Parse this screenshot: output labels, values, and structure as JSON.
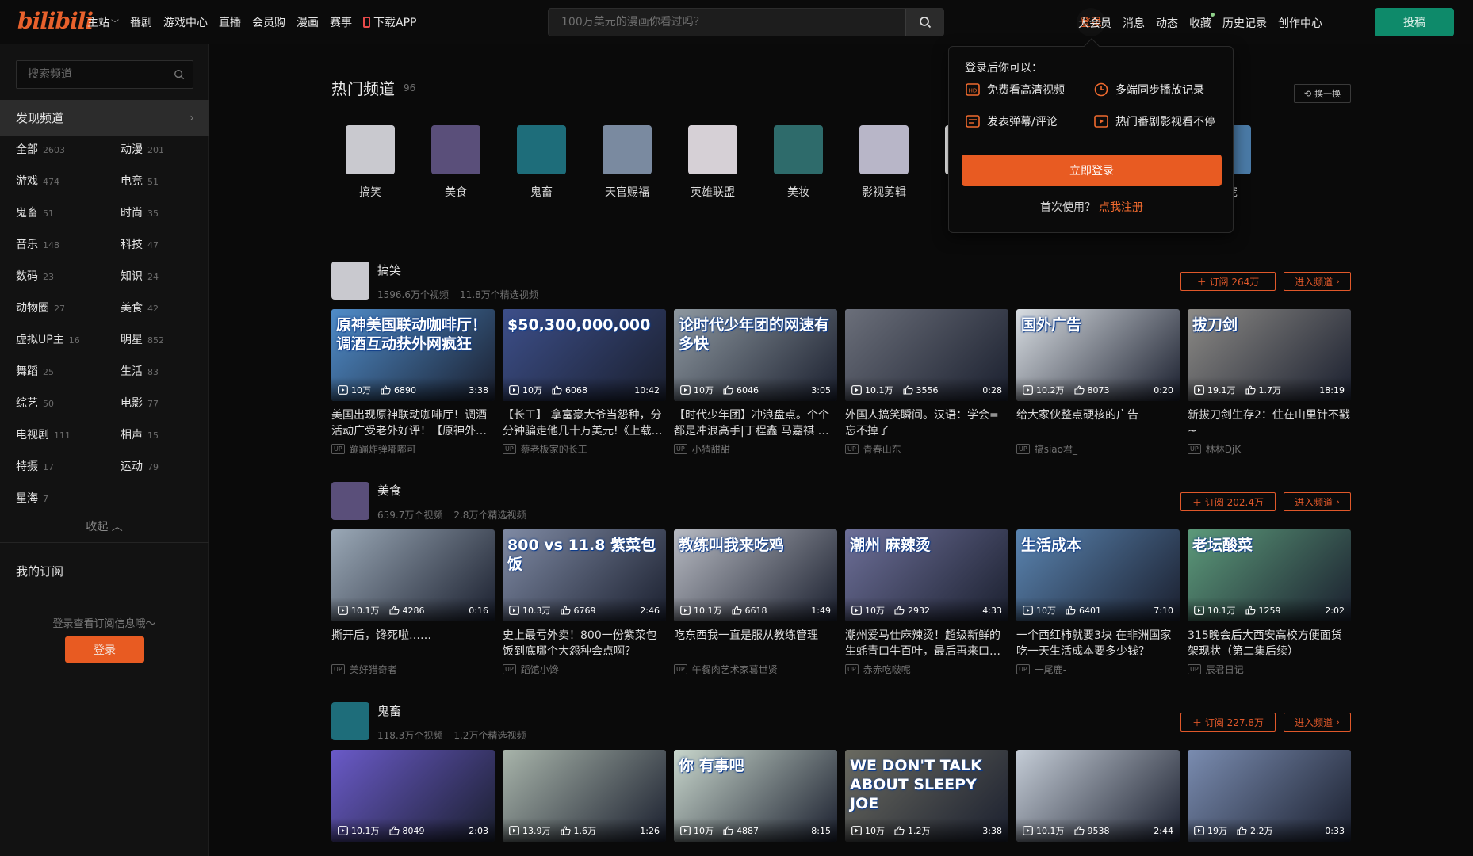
{
  "header": {
    "logo": "bilibili",
    "nav": [
      "主站",
      "番剧",
      "游戏中心",
      "直播",
      "会员购",
      "漫画",
      "赛事",
      "下载APP"
    ],
    "search_placeholder": "100万美元的漫画你看过吗？",
    "login": "登录",
    "right_nav": [
      "大会员",
      "消息",
      "动态",
      "收藏",
      "历史记录",
      "创作中心"
    ],
    "post": "投稿"
  },
  "sidebar": {
    "search_placeholder": "搜索频道",
    "discover": "发现频道",
    "categories": [
      {
        "name": "全部",
        "count": "2603"
      },
      {
        "name": "动漫",
        "count": "201"
      },
      {
        "name": "游戏",
        "count": "474"
      },
      {
        "name": "电竞",
        "count": "51"
      },
      {
        "name": "鬼畜",
        "count": "51"
      },
      {
        "name": "时尚",
        "count": "35"
      },
      {
        "name": "音乐",
        "count": "148"
      },
      {
        "name": "科技",
        "count": "47"
      },
      {
        "name": "数码",
        "count": "23"
      },
      {
        "name": "知识",
        "count": "24"
      },
      {
        "name": "动物圈",
        "count": "27"
      },
      {
        "name": "美食",
        "count": "42"
      },
      {
        "name": "虚拟UP主",
        "count": "16"
      },
      {
        "name": "明星",
        "count": "852"
      },
      {
        "name": "舞蹈",
        "count": "25"
      },
      {
        "name": "生活",
        "count": "83"
      },
      {
        "name": "综艺",
        "count": "50"
      },
      {
        "name": "电影",
        "count": "77"
      },
      {
        "name": "电视剧",
        "count": "111"
      },
      {
        "name": "相声",
        "count": "15"
      },
      {
        "name": "特摄",
        "count": "17"
      },
      {
        "name": "运动",
        "count": "79"
      },
      {
        "name": "星海",
        "count": "7"
      }
    ],
    "collapse": "收起",
    "my_sub": "我的订阅",
    "login_tip": "登录查看订阅信息哦～",
    "login_btn": "登录"
  },
  "hot": {
    "title": "热门频道",
    "count": "96",
    "refresh": "换一换",
    "channels": [
      {
        "name": "搞笑",
        "color": "#c9c9cf"
      },
      {
        "name": "美食",
        "color": "#5a4f7a"
      },
      {
        "name": "鬼畜",
        "color": "#1e6d7a"
      },
      {
        "name": "天官赐福",
        "color": "#7a8aa0"
      },
      {
        "name": "英雄联盟",
        "color": "#d6d0d6"
      },
      {
        "name": "美妆",
        "color": "#2e6b6b"
      },
      {
        "name": "影视剪辑",
        "color": "#b8b6c8"
      },
      {
        "name": "",
        "color": "#ffffff"
      },
      {
        "name": "",
        "color": "#cfd4e6"
      },
      {
        "name": "",
        "color": "#c6d4ea"
      },
      {
        "name": "萌宠",
        "color": "#4a7aa6"
      }
    ]
  },
  "popup": {
    "title": "登录后你可以：",
    "items": [
      "免费看高清视频",
      "多端同步播放记录",
      "发表弹幕/评论",
      "热门番剧影视看不停"
    ],
    "login": "立即登录",
    "first_use": "首次使用？",
    "register": "点我注册"
  },
  "sections": [
    {
      "name": "搞笑",
      "videos_count": "1596.6万个视频",
      "featured_count": "11.8万个精选视频",
      "subscribe": "订阅 264万",
      "enter": "进入频道",
      "avatar_color": "#c9c9cf",
      "cards": [
        {
          "thumb": "原神美国联动咖啡厅！调酒互动获外网疯狂",
          "bg": "#4f8cc9",
          "plays": "10万",
          "likes": "6890",
          "duration": "3:38",
          "title": "美国出现原神联动咖啡厅！调酒活动广受老外好评！【原神外…",
          "up": "蹦蹦炸弹嘟嘟可"
        },
        {
          "thumb": "$50,300,000,000",
          "bg": "#3d4f8a",
          "plays": "10万",
          "likes": "6068",
          "duration": "10:42",
          "title": "【长工】 拿富豪大爷当怨种，分分钟骗走他几十万美元!《上载…",
          "up": "蔡老板家的长工"
        },
        {
          "thumb": "论时代少年团的网速有多快",
          "bg": "#8e98a0",
          "plays": "10万",
          "likes": "6046",
          "duration": "3:05",
          "title": "【时代少年团】冲浪盘点。个个都是冲浪高手|丁程鑫 马嘉祺 …",
          "up": "小猜甜甜"
        },
        {
          "thumb": "",
          "bg": "#6b6f7a",
          "plays": "10.1万",
          "likes": "3556",
          "duration": "0:28",
          "title": "外国人搞笑瞬间。汉语：学会=忘不掉了",
          "up": "青春山东"
        },
        {
          "thumb": "国外广告",
          "bg": "#d8dde2",
          "plays": "10.2万",
          "likes": "8073",
          "duration": "0:20",
          "title": "给大家伙整点硬核的广告",
          "up": "搞siao君_"
        },
        {
          "thumb": "拔刀剑",
          "bg": "#8c8a86",
          "plays": "19.1万",
          "likes": "1.7万",
          "duration": "18:19",
          "title": "新拔刀剑生存2：住在山里针不戳~",
          "up": "林林DjK"
        }
      ]
    },
    {
      "name": "美食",
      "videos_count": "659.7万个视频",
      "featured_count": "2.8万个精选视频",
      "subscribe": "订阅 202.4万",
      "enter": "进入频道",
      "avatar_color": "#5a4f7a",
      "cards": [
        {
          "thumb": "",
          "bg": "#9aa8b6",
          "plays": "10.1万",
          "likes": "4286",
          "duration": "0:16",
          "title": "撕开后，馋死啦……",
          "up": "美好猎奇者"
        },
        {
          "thumb": "800 vs 11.8 紫菜包饭",
          "bg": "#7f8aa4",
          "plays": "10.3万",
          "likes": "6769",
          "duration": "2:46",
          "title": "史上最亏外卖！800一份紫菜包饭到底哪个大怨种会点啊？",
          "up": "蹈馆小馋"
        },
        {
          "thumb": "教练叫我来吃鸡",
          "bg": "#b7bac2",
          "plays": "10.1万",
          "likes": "6618",
          "duration": "1:49",
          "title": "吃东西我一直是服从教练管理",
          "up": "午餐肉艺术家葛世贤"
        },
        {
          "thumb": "潮州 麻辣烫",
          "bg": "#6d6f98",
          "plays": "10万",
          "likes": "2932",
          "duration": "4:33",
          "title": "潮州爱马仕麻辣烫！超级新鲜的生蚝青口牛百叶，最后再来口…",
          "up": "赤赤吃啵呢"
        },
        {
          "thumb": "生活成本",
          "bg": "#5a84b0",
          "plays": "10万",
          "likes": "6401",
          "duration": "7:10",
          "title": "一个西红柿就要3块 在非洲国家吃一天生活成本要多少钱？",
          "up": "一尾鹿-"
        },
        {
          "thumb": "老坛酸菜",
          "bg": "#5c9a7a",
          "plays": "10.1万",
          "likes": "1259",
          "duration": "2:02",
          "title": "315晚会后大西安高校方便面货架现状（第二集后续）",
          "up": "辰君日记"
        }
      ]
    },
    {
      "name": "鬼畜",
      "videos_count": "118.3万个视频",
      "featured_count": "1.2万个精选视频",
      "subscribe": "订阅 227.8万",
      "enter": "进入频道",
      "avatar_color": "#1e6d7a",
      "cards": [
        {
          "thumb": "",
          "bg": "#6a5ac8",
          "plays": "10.1万",
          "likes": "8049",
          "duration": "2:03",
          "title": "",
          "up": ""
        },
        {
          "thumb": "",
          "bg": "#a8b4aa",
          "plays": "13.9万",
          "likes": "1.6万",
          "duration": "1:26",
          "title": "",
          "up": ""
        },
        {
          "thumb": "你 有事吧",
          "bg": "#c8d6cc",
          "plays": "10万",
          "likes": "4887",
          "duration": "8:15",
          "title": "",
          "up": ""
        },
        {
          "thumb": "WE DON'T TALK ABOUT SLEEPY JOE",
          "bg": "#6a6a60",
          "plays": "10万",
          "likes": "1.2万",
          "duration": "3:38",
          "title": "",
          "up": ""
        },
        {
          "thumb": "",
          "bg": "#c4ccd6",
          "plays": "10.1万",
          "likes": "9538",
          "duration": "2:44",
          "title": "",
          "up": ""
        },
        {
          "thumb": "",
          "bg": "#7a8cb0",
          "plays": "19万",
          "likes": "2.2万",
          "duration": "0:33",
          "title": "",
          "up": ""
        }
      ]
    }
  ]
}
